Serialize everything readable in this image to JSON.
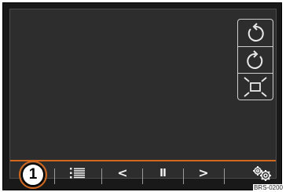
{
  "callout": {
    "number": "1"
  },
  "side_panel": {
    "buttons": [
      {
        "icon": "rotate-left-icon"
      },
      {
        "icon": "rotate-right-icon"
      },
      {
        "icon": "fit-screen-icon"
      }
    ]
  },
  "bottom_bar": {
    "list_icon": "list-icon",
    "prev_label": "<",
    "pause_label": "II",
    "next_label": ">",
    "settings_icon": "settings-gears-icon"
  },
  "colors": {
    "accent": "#d2691e",
    "screen": "#2d2d2d",
    "frame": "#191919"
  },
  "image_code": "BRS-0200"
}
